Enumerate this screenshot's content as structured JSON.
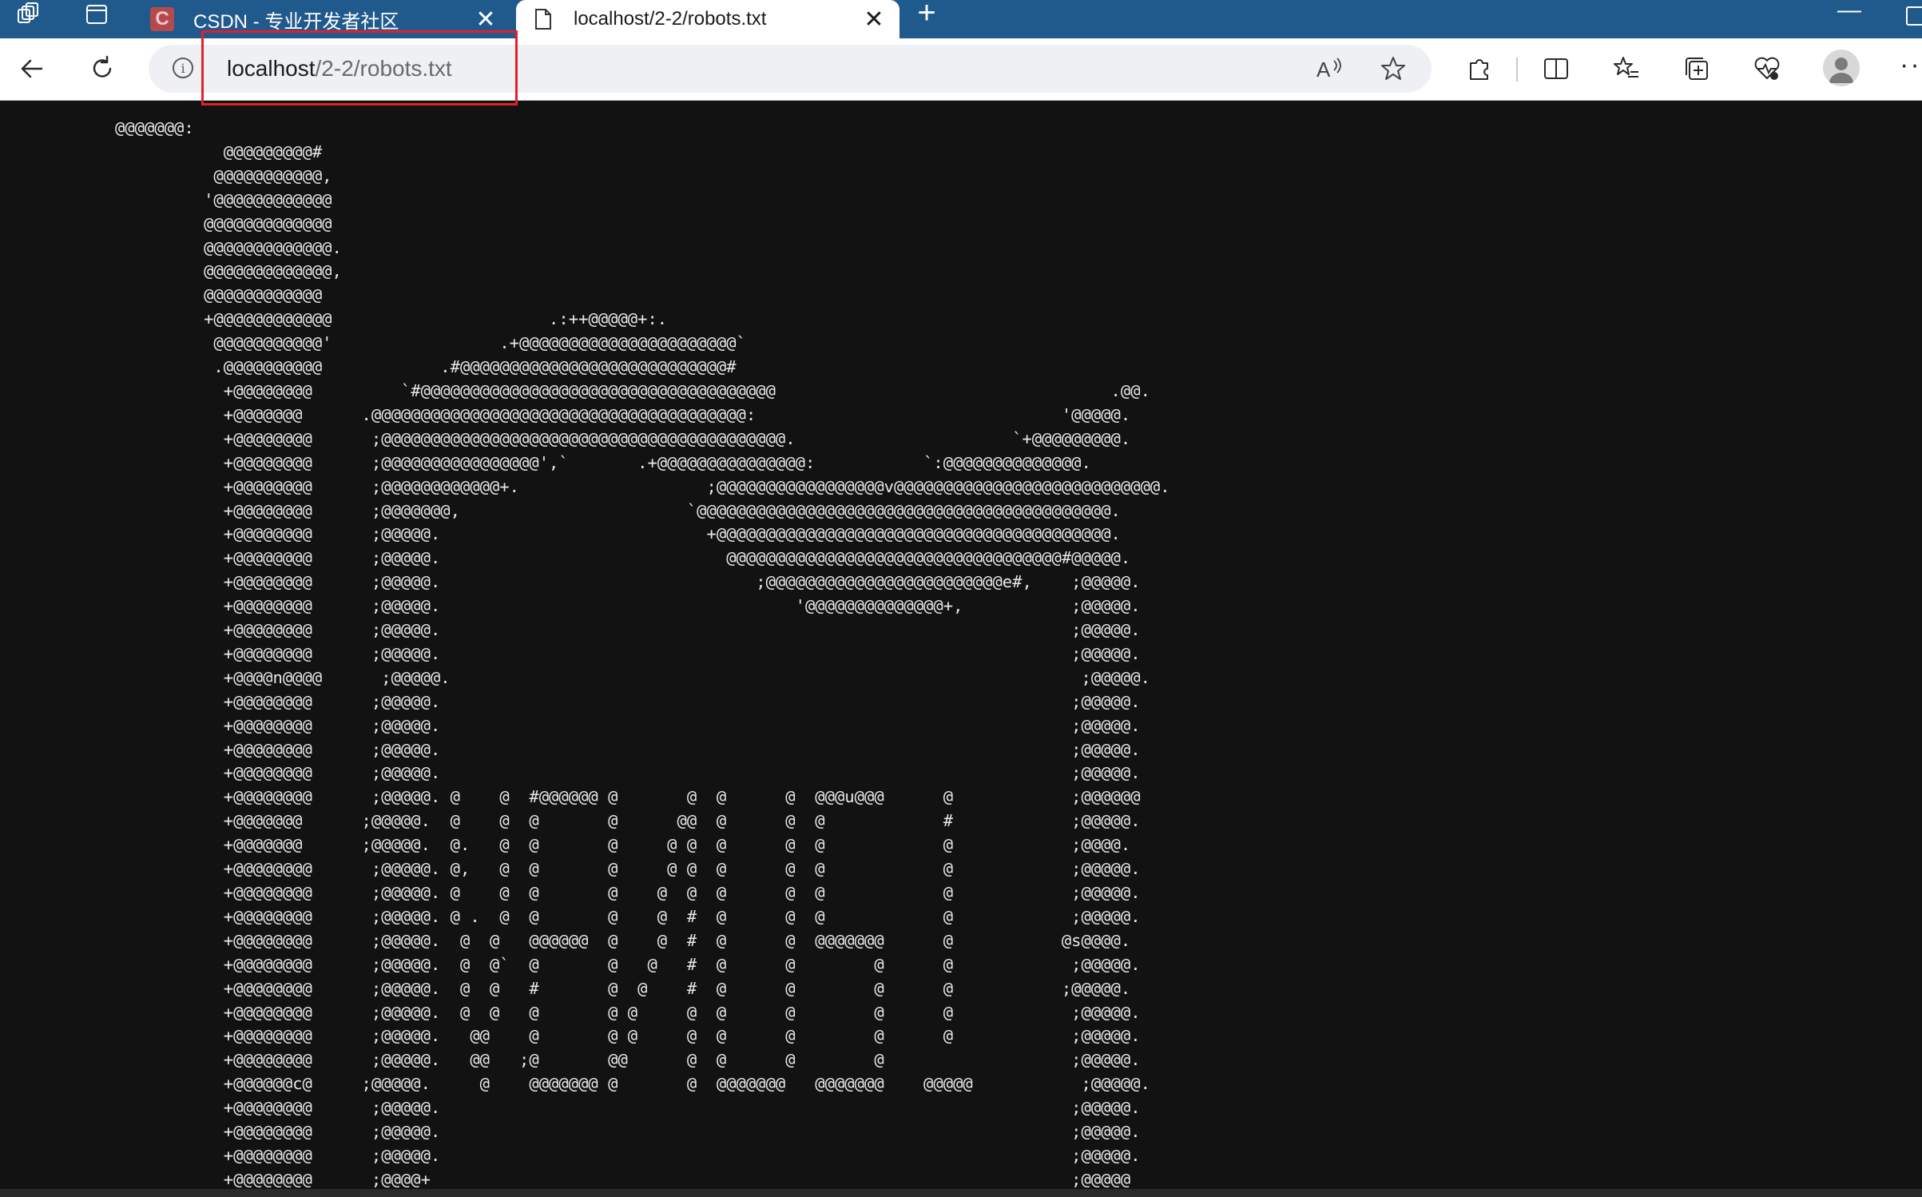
{
  "tabs": [
    {
      "title": "CSDN - 专业开发者社区",
      "favicon": "C",
      "active": false
    },
    {
      "title": "localhost/2-2/robots.txt",
      "active": true
    }
  ],
  "icons": {
    "workspaces": "workspaces-icon",
    "tab_actions": "tab-actions-icon",
    "new_tab": "+",
    "close": "✕",
    "minimize": "—"
  },
  "address_bar": {
    "host": "localhost",
    "path": "/2-2/robots.txt"
  },
  "colors": {
    "tabstrip": "#205a8c",
    "page_background": "#121212",
    "ascii_text": "#e8e8e8",
    "highlight": "#e0202a"
  },
  "content": {
    "ascii_art": "@@@@@@@:\n           @@@@@@@@@#\n          @@@@@@@@@@@,\n         '@@@@@@@@@@@@\n         @@@@@@@@@@@@@\n         @@@@@@@@@@@@@.\n         @@@@@@@@@@@@@,\n         @@@@@@@@@@@@\n         +@@@@@@@@@@@@                      .:++@@@@@+:.\n          @@@@@@@@@@@'                 .+@@@@@@@@@@@@@@@@@@@@@@`\n          .@@@@@@@@@@            .#@@@@@@@@@@@@@@@@@@@@@@@@@@@#\n           +@@@@@@@@         `#@@@@@@@@@@@@@@@@@@@@@@@@@@@@@@@@@@@@                                  .@@.\n           +@@@@@@@      .@@@@@@@@@@@@@@@@@@@@@@@@@@@@@@@@@@@@@@:                               '@@@@@.\n           +@@@@@@@@      ;@@@@@@@@@@@@@@@@@@@@@@@@@@@@@@@@@@@@@@@@@.                      `+@@@@@@@@@.\n           +@@@@@@@@      ;@@@@@@@@@@@@@@@@',`       .+@@@@@@@@@@@@@@@:           `:@@@@@@@@@@@@@@.\n           +@@@@@@@@      ;@@@@@@@@@@@@+.                   ;@@@@@@@@@@@@@@@@@v@@@@@@@@@@@@@@@@@@@@@@@@@@@.\n           +@@@@@@@@      ;@@@@@@@,                       `@@@@@@@@@@@@@@@@@@@@@@@@@@@@@@@@@@@@@@@@@@.\n           +@@@@@@@@      ;@@@@@.                           +@@@@@@@@@@@@@@@@@@@@@@@@@@@@@@@@@@@@@@@@.\n           +@@@@@@@@      ;@@@@@.                             @@@@@@@@@@@@@@@@@@@@@@@@@@@@@@@@@@#@@@@@.\n           +@@@@@@@@      ;@@@@@.                                ;@@@@@@@@@@@@@@@@@@@@@@@@e#,    ;@@@@@.\n           +@@@@@@@@      ;@@@@@.                                    '@@@@@@@@@@@@@@+,           ;@@@@@.\n           +@@@@@@@@      ;@@@@@.                                                                ;@@@@@.\n           +@@@@@@@@      ;@@@@@.                                                                ;@@@@@.\n           +@@@@n@@@@      ;@@@@@.                                                                ;@@@@@.\n           +@@@@@@@@      ;@@@@@.                                                                ;@@@@@.\n           +@@@@@@@@      ;@@@@@.                                                                ;@@@@@.\n           +@@@@@@@@      ;@@@@@.                                                                ;@@@@@.\n           +@@@@@@@@      ;@@@@@.                                                                ;@@@@@.\n           +@@@@@@@@      ;@@@@@. @    @  #@@@@@@ @       @  @      @  @@@u@@@      @            ;@@@@@@\n           +@@@@@@@      ;@@@@@.  @    @  @       @      @@  @      @  @            #            ;@@@@@.\n           +@@@@@@@      ;@@@@@.  @.   @  @       @     @ @  @      @  @            @            ;@@@@.\n           +@@@@@@@@      ;@@@@@. @,   @  @       @     @ @  @      @  @            @            ;@@@@@.\n           +@@@@@@@@      ;@@@@@. @    @  @       @    @  @  @      @  @            @            ;@@@@@.\n           +@@@@@@@@      ;@@@@@. @ .  @  @       @    @  #  @      @  @            @            ;@@@@@.\n           +@@@@@@@@      ;@@@@@.  @  @   @@@@@@  @    @  #  @      @  @@@@@@@      @           @s@@@@.\n           +@@@@@@@@      ;@@@@@.  @  @`  @       @   @   #  @      @        @      @            ;@@@@@.\n           +@@@@@@@@      ;@@@@@.  @  @   #       @  @    #  @      @        @      @           ;@@@@@.\n           +@@@@@@@@      ;@@@@@.  @  @   @       @ @     @  @      @        @      @            ;@@@@@.\n           +@@@@@@@@      ;@@@@@.   @@    @       @ @     @  @      @        @      @            ;@@@@@.\n           +@@@@@@@@      ;@@@@@.   @@   ;@       @@      @  @      @        @                   ;@@@@@.\n           +@@@@@@c@     ;@@@@@.     @    @@@@@@@ @       @  @@@@@@@   @@@@@@@    @@@@@           ;@@@@@.\n           +@@@@@@@@      ;@@@@@.                                                                ;@@@@@.\n           +@@@@@@@@      ;@@@@@.                                                                ;@@@@@.\n           +@@@@@@@@      ;@@@@@.                                                                ;@@@@@.\n           +@@@@@@@@      ;@@@@+                                                                 ;@@@@@"
  }
}
